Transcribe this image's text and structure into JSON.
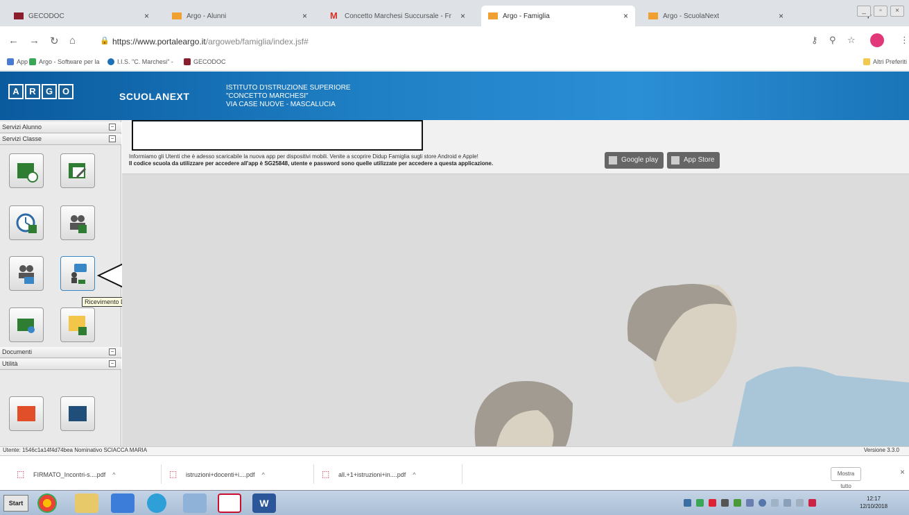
{
  "browser": {
    "tabs": [
      {
        "title": "GECODOC",
        "color": "#8b1e2c",
        "active": false
      },
      {
        "title": "Argo - Alunni",
        "color": "#f0a030",
        "active": false
      },
      {
        "title": "Concetto Marchesi Succursale - Fr",
        "color": "#d93025",
        "active": false
      },
      {
        "title": "Argo - Famiglia",
        "color": "#f0a030",
        "active": true
      },
      {
        "title": "Argo - ScuolaNext",
        "color": "#f0a030",
        "active": false
      }
    ],
    "url_main": "https://www.portaleargo.it",
    "url_path": "/argoweb/famiglia/index.jsf#",
    "bookmarks": [
      {
        "label": "App",
        "color": "#4a7bd1"
      },
      {
        "label": "Argo - Software per la",
        "color": "#3aa757"
      },
      {
        "label": "I.I.S. \"C. Marchesi\" - ",
        "color": "#1d6fb8"
      },
      {
        "label": "GECODOC",
        "color": "#8b1e2c"
      }
    ],
    "other_bookmarks": "Altri Preferiti"
  },
  "header": {
    "logo_letters": [
      "A",
      "R",
      "G",
      "O"
    ],
    "brand": "SCUOLANEXT",
    "school_line1": "ISTITUTO D'ISTRUZIONE SUPERIORE",
    "school_line2": "\"CONCETTO MARCHESI\"",
    "school_line3": "VIA CASE NUOVE - MASCALUCIA"
  },
  "sidebar": {
    "sections": [
      "Servizi Alunno",
      "Servizi Classe",
      "Documenti",
      "Utilità"
    ],
    "tooltip": "Ricevimento Docenti"
  },
  "main": {
    "info_line1": "Informiamo gli Utenti che è adesso scaricabile la nuova app per dispositivi mobili. Venite a scoprire Didup Famiglia sugli store Android e Apple!",
    "info_line2": "Il codice scuola da utilizzare per accedere all'app è SG25848, utente e password sono quelle utilizzate per accedere a questa applicazione.",
    "google_play": "Google play",
    "app_store": "App Store"
  },
  "status": {
    "user": "Utente: 1546c1a14f4d74bea Nominativo SCIACCA MARIA",
    "version": "Versione 3.3.0"
  },
  "downloads": {
    "items": [
      "FIRMATO_Incontri-s....pdf",
      "istruzioni+docenti+i....pdf",
      "all.+1+istruzioni+in....pdf"
    ],
    "show_all": "Mostra tutto"
  },
  "taskbar": {
    "start": "Start",
    "time": "12:17",
    "date": "12/10/2018"
  }
}
